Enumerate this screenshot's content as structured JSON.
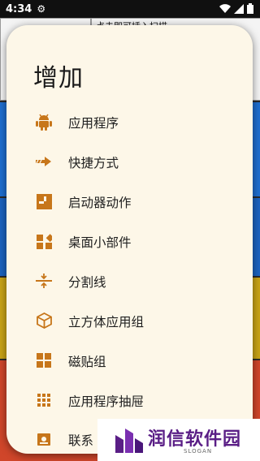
{
  "status_bar": {
    "time": "4:34"
  },
  "background": {
    "partial_text": "点击即可插入扫描"
  },
  "dialog": {
    "title": "增加",
    "items": [
      {
        "label": "应用程序",
        "icon": "android-icon"
      },
      {
        "label": "快捷方式",
        "icon": "arrow-right-icon"
      },
      {
        "label": "启动器动作",
        "icon": "launcher-action-icon"
      },
      {
        "label": "桌面小部件",
        "icon": "widgets-icon"
      },
      {
        "label": "分割线",
        "icon": "divider-icon"
      },
      {
        "label": "立方体应用组",
        "icon": "cube-icon"
      },
      {
        "label": "磁贴组",
        "icon": "tiles-icon"
      },
      {
        "label": "应用程序抽屉",
        "icon": "app-drawer-icon"
      },
      {
        "label": "联系",
        "icon": "contact-icon"
      }
    ]
  },
  "watermark": {
    "text": "润信软件园",
    "slogan": "SLOGAN"
  },
  "colors": {
    "accent": "#c7761a",
    "dialog_bg": "#fdf7e8",
    "watermark": "#5a1e86"
  }
}
